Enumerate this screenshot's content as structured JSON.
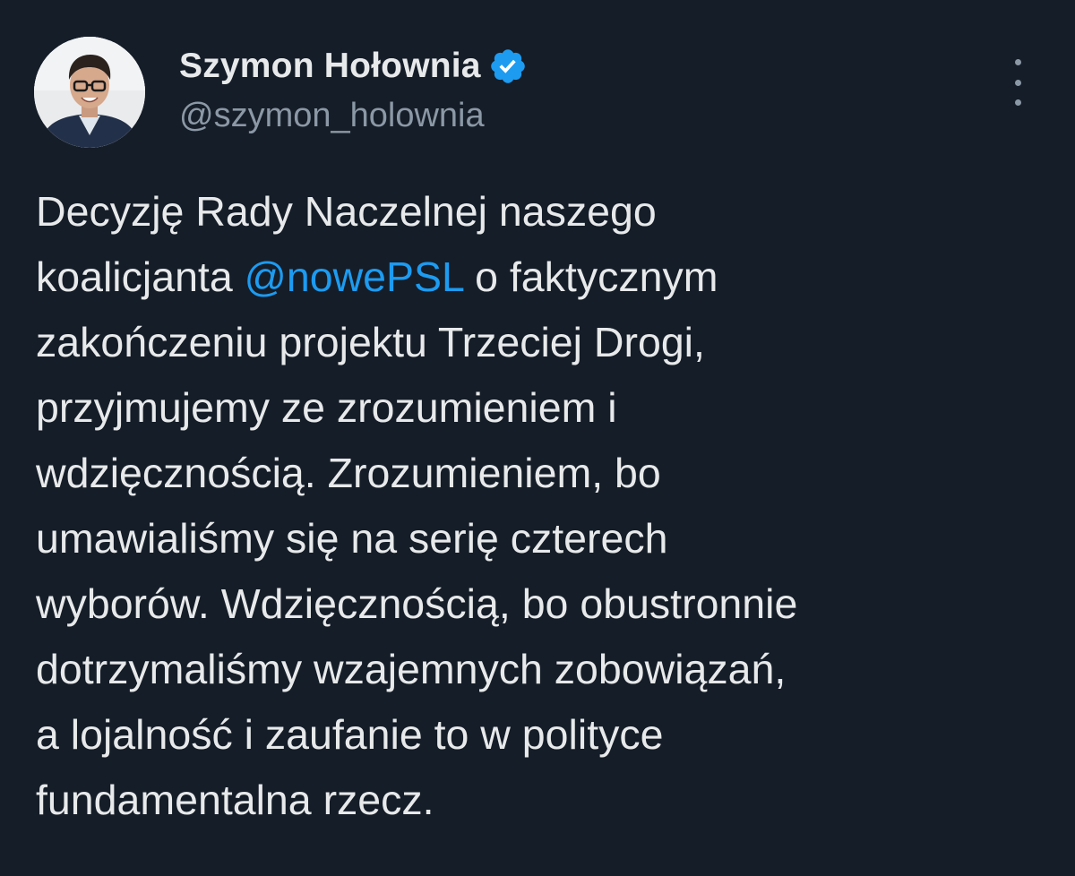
{
  "author": {
    "display_name": "Szymon Hołownia",
    "handle": "@szymon_holownia",
    "verified_icon": "verified-badge-icon",
    "verified_color": "#1d9bf0"
  },
  "menu": {
    "icon": "more-vertical-icon"
  },
  "tweet": {
    "lines": [
      {
        "text": "Decyzję Rady Naczelnej naszego"
      },
      {
        "pre": "koalicjanta ",
        "mention": "@nowePSL",
        "post": " o faktycznym"
      },
      {
        "text": "zakończeniu projektu Trzeciej Drogi,"
      },
      {
        "text": "przyjmujemy ze zrozumieniem i"
      },
      {
        "text": "wdzięcznością. Zrozumieniem, bo"
      },
      {
        "text": "umawialiśmy się na serię czterech"
      },
      {
        "text": "wyborów. Wdzięcznością, bo obustronnie"
      },
      {
        "text": "dotrzymaliśmy wzajemnych zobowiązań,"
      },
      {
        "text": "a lojalność i zaufanie to w polityce"
      },
      {
        "text": "fundamentalna rzecz."
      }
    ]
  },
  "colors": {
    "background": "#151d28",
    "text_primary": "#e7e9ea",
    "text_secondary": "#8b98a5",
    "link": "#1d9bf0"
  }
}
